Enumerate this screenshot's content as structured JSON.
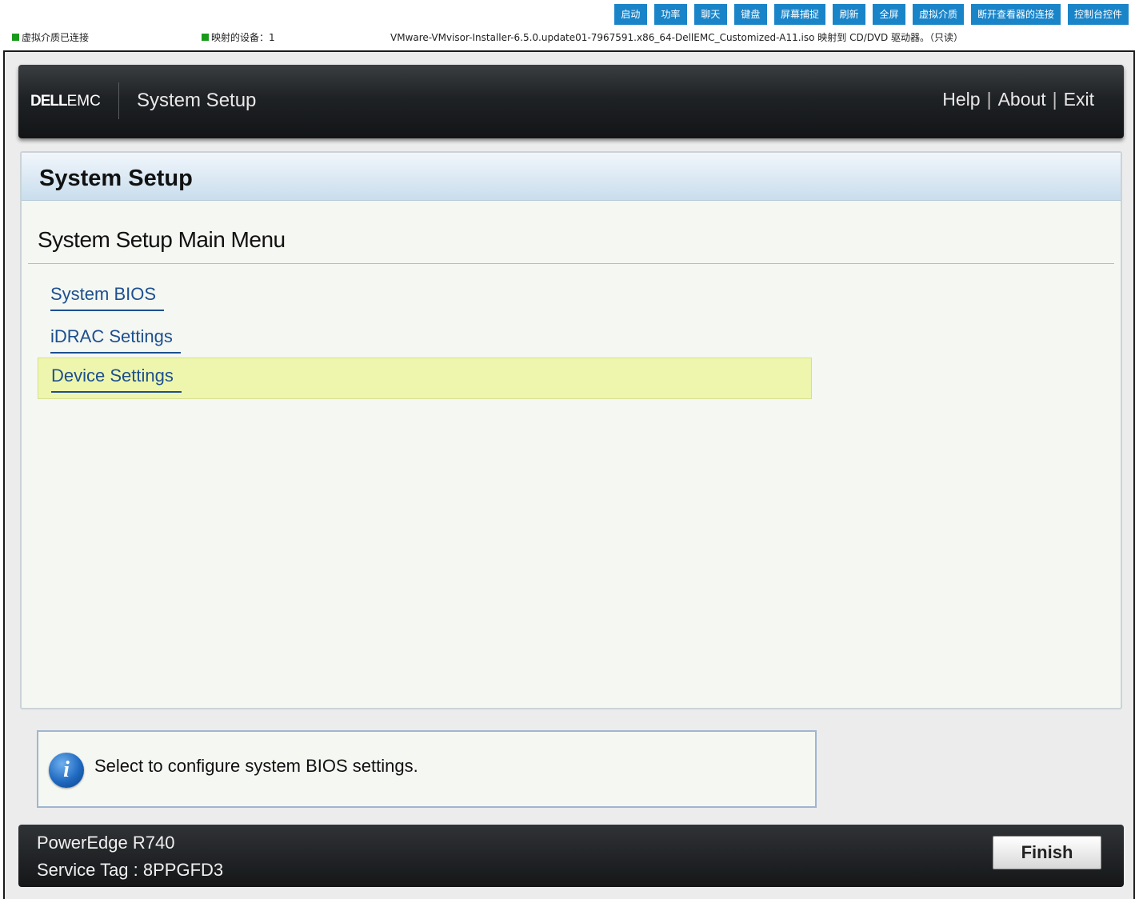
{
  "toolbar": {
    "buttons": [
      "启动",
      "功率",
      "聊天",
      "键盘",
      "屏幕捕捉",
      "刷新",
      "全屏",
      "虚拟介质",
      "断开查看器的连接",
      "控制台控件"
    ],
    "color": "#1a84c8"
  },
  "status": {
    "virtual_media": "虚拟介质已连接",
    "mapped_devices": "映射的设备：1",
    "iso_message": "VMware-VMvisor-Installer-6.5.0.update01-7967591.x86_64-DellEMC_Customized-A11.iso 映射到 CD/DVD 驱动器。（只读）",
    "indicator_color": "#1a9a1a"
  },
  "header": {
    "logo_dell": "DELL",
    "logo_emc": "EMC",
    "title": "System Setup",
    "links": {
      "help": "Help",
      "about": "About",
      "exit": "Exit",
      "separator": "|"
    }
  },
  "panel": {
    "title": "System Setup",
    "menu_title": "System Setup Main Menu",
    "items": [
      {
        "label": "System BIOS",
        "selected": false
      },
      {
        "label": "iDRAC Settings",
        "selected": false
      },
      {
        "label": "Device Settings",
        "selected": true
      }
    ]
  },
  "help": {
    "icon": "info-icon",
    "icon_glyph": "i",
    "text": "Select to configure system BIOS settings."
  },
  "footer": {
    "model": "PowerEdge R740",
    "service_tag": "Service Tag : 8PPGFD3",
    "finish_label": "Finish"
  }
}
